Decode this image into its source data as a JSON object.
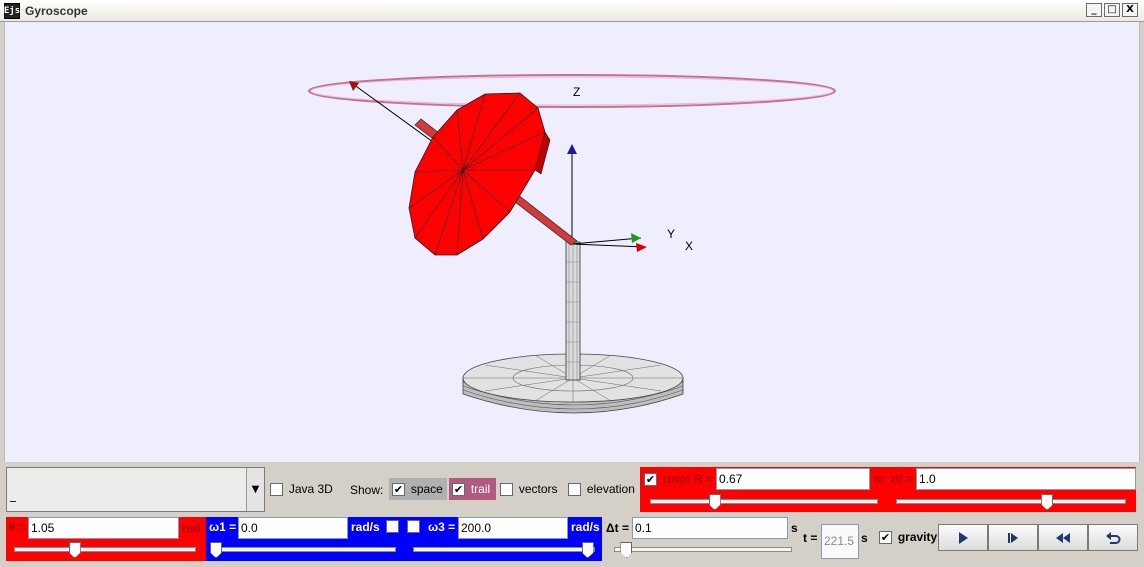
{
  "window": {
    "title": "Gyroscope",
    "icon_text": "Ejs",
    "buttons": [
      "_",
      "□",
      "X"
    ]
  },
  "scene": {
    "axis_labels": {
      "z": "Z",
      "y": "Y",
      "x": "X"
    },
    "colors": {
      "rotor": "#ff0000",
      "trail": "#c87090",
      "background": "#eeeefe",
      "base": "#d6d6d6"
    }
  },
  "controls": {
    "combo": {
      "value": "_"
    },
    "java3d": {
      "label": "Java 3D",
      "checked": false
    },
    "show_label": "Show:",
    "space": {
      "label": "space",
      "checked": true
    },
    "trail": {
      "label": "trail",
      "checked": true
    },
    "vectors": {
      "label": "vectors",
      "checked": false
    },
    "elevation": {
      "label": "elevation",
      "checked": false
    },
    "rotor": {
      "label": "rotor",
      "checked": true
    },
    "R": {
      "label": "R =",
      "value": "0.67",
      "slider": 0.28
    },
    "m": {
      "label": "m",
      "z0_label": "z0 =",
      "value": "1.0",
      "slider": 0.66
    },
    "theta": {
      "label": "θ =",
      "value": "1.05",
      "unit": "rad",
      "slider": 0.33
    },
    "omega1": {
      "label": "ω1 =",
      "value": "0.0",
      "unit": "rad/s",
      "slider": 0.0
    },
    "omega3": {
      "label": "ω3 =",
      "value": "200.0",
      "unit": "rad/s",
      "slider": 0.97
    },
    "toggles_mid": [
      {
        "checked": false
      },
      {
        "checked": false
      }
    ],
    "dt": {
      "label": "Δt =",
      "value": "0.1",
      "unit": "s",
      "slider": 0.06
    },
    "t": {
      "label": "t =",
      "value": "221.5",
      "unit": "s"
    },
    "gravity": {
      "label": "gravity",
      "checked": true
    },
    "buttons": [
      "play-icon",
      "step-icon",
      "rewind-icon",
      "reset-icon"
    ]
  }
}
